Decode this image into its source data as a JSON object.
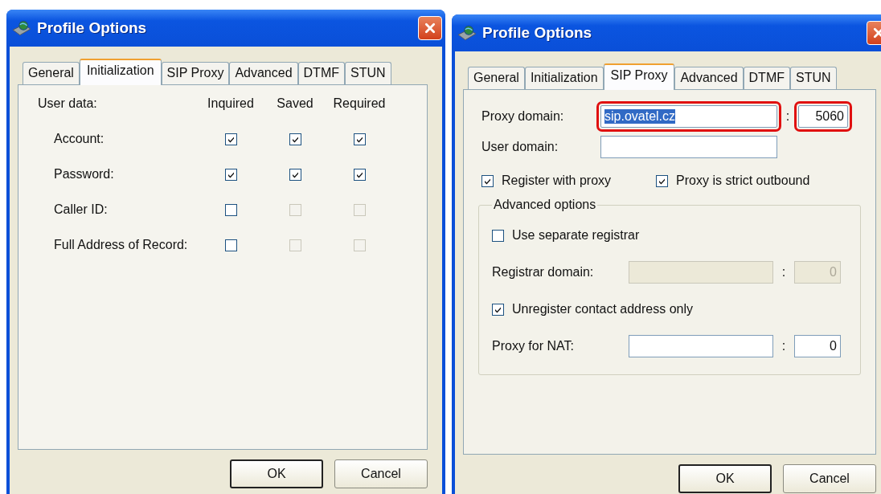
{
  "windows": [
    {
      "title": "Profile Options",
      "tabs": [
        {
          "label": "General",
          "selected": false
        },
        {
          "label": "Initialization",
          "selected": true
        },
        {
          "label": "SIP Proxy",
          "selected": false
        },
        {
          "label": "Advanced",
          "selected": false
        },
        {
          "label": "DTMF",
          "selected": false
        },
        {
          "label": "STUN",
          "selected": false
        }
      ],
      "panel": {
        "kind": "initialization",
        "header": "User data:",
        "columns": [
          "Inquired",
          "Saved",
          "Required"
        ],
        "rows": [
          {
            "label": "Account:",
            "checks": [
              {
                "checked": true,
                "disabled": false
              },
              {
                "checked": true,
                "disabled": false
              },
              {
                "checked": true,
                "disabled": false
              }
            ]
          },
          {
            "label": "Password:",
            "checks": [
              {
                "checked": true,
                "disabled": false
              },
              {
                "checked": true,
                "disabled": false
              },
              {
                "checked": true,
                "disabled": false
              }
            ]
          },
          {
            "label": "Caller ID:",
            "checks": [
              {
                "checked": false,
                "disabled": false
              },
              {
                "checked": false,
                "disabled": true
              },
              {
                "checked": false,
                "disabled": true
              }
            ]
          },
          {
            "label": "Full Address of Record:",
            "checks": [
              {
                "checked": false,
                "disabled": false
              },
              {
                "checked": false,
                "disabled": true
              },
              {
                "checked": false,
                "disabled": true
              }
            ]
          }
        ]
      },
      "buttons": [
        {
          "label": "OK",
          "default": true
        },
        {
          "label": "Cancel",
          "default": false
        }
      ]
    },
    {
      "title": "Profile Options",
      "tabs": [
        {
          "label": "General",
          "selected": false
        },
        {
          "label": "Initialization",
          "selected": false
        },
        {
          "label": "SIP Proxy",
          "selected": true
        },
        {
          "label": "Advanced",
          "selected": false
        },
        {
          "label": "DTMF",
          "selected": false
        },
        {
          "label": "STUN",
          "selected": false
        }
      ],
      "panel": {
        "kind": "sip_proxy",
        "proxy_domain": {
          "label": "Proxy domain:",
          "value": "sip.ovatel.cz",
          "text_selected": true,
          "circled": true,
          "separator": ":",
          "port": {
            "value": "5060",
            "circled": true
          }
        },
        "user_domain": {
          "label": "User domain:"
        },
        "options": [
          {
            "label": "Register with proxy",
            "checked": true
          },
          {
            "label": "Proxy is strict outbound",
            "checked": true
          }
        ],
        "group": {
          "title": "Advanced options",
          "items": [
            {
              "kind": "checkbox",
              "label": "Use separate registrar",
              "checked": false
            },
            {
              "kind": "field",
              "label": "Registrar domain:",
              "disabled": true,
              "separator": ":",
              "port": "0"
            },
            {
              "kind": "checkbox",
              "label": "Unregister contact address only",
              "checked": true
            },
            {
              "kind": "field",
              "label": "Proxy for NAT:",
              "disabled": false,
              "separator": ":",
              "port": "0"
            }
          ]
        }
      },
      "buttons": [
        {
          "label": "OK",
          "default": true
        },
        {
          "label": "Cancel",
          "default": false
        }
      ]
    }
  ]
}
